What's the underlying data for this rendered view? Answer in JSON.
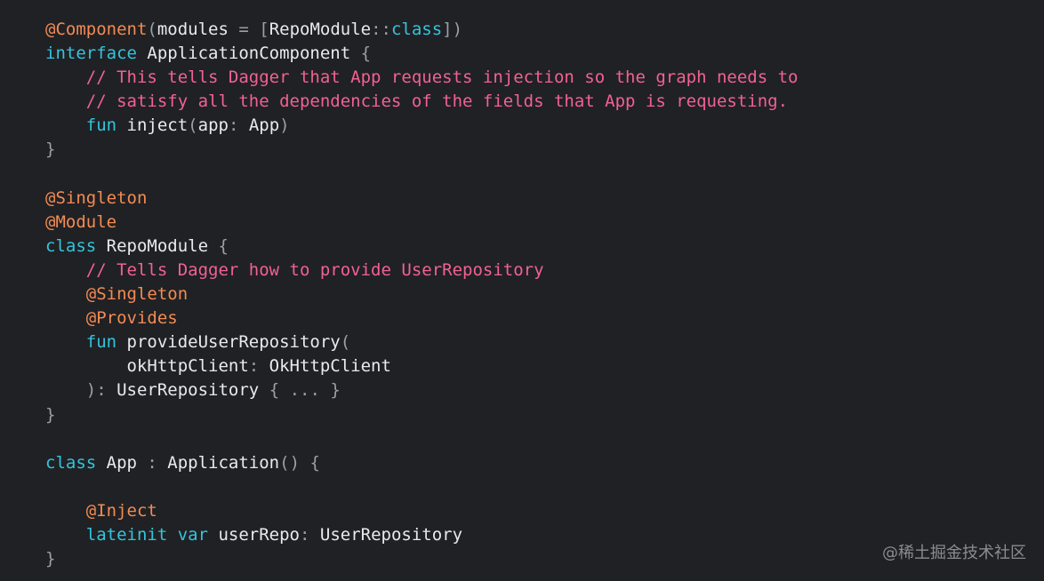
{
  "colors": {
    "background": "#202124",
    "annotation": "#f28b54",
    "keyword": "#33c4de",
    "comment": "#f06292",
    "punctuation": "#9aa0a6",
    "identifier": "#e8eaed"
  },
  "code": {
    "lines": [
      [
        [
          "ann",
          "@Component"
        ],
        [
          "pn",
          "("
        ],
        [
          "id",
          "modules "
        ],
        [
          "pn",
          "= ["
        ],
        [
          "id",
          "RepoModule"
        ],
        [
          "pn",
          "::"
        ],
        [
          "kw",
          "class"
        ],
        [
          "pn",
          "])"
        ]
      ],
      [
        [
          "kw",
          "interface "
        ],
        [
          "id",
          "ApplicationComponent "
        ],
        [
          "pn",
          "{"
        ]
      ],
      [
        [
          "id",
          "    "
        ],
        [
          "cm",
          "// This tells Dagger that App requests injection so the graph needs to"
        ]
      ],
      [
        [
          "id",
          "    "
        ],
        [
          "cm",
          "// satisfy all the dependencies of the fields that App is requesting."
        ]
      ],
      [
        [
          "id",
          "    "
        ],
        [
          "kw",
          "fun "
        ],
        [
          "id",
          "inject"
        ],
        [
          "pn",
          "("
        ],
        [
          "id",
          "app"
        ],
        [
          "pn",
          ": "
        ],
        [
          "id",
          "App"
        ],
        [
          "pn",
          ")"
        ]
      ],
      [
        [
          "pn",
          "}"
        ]
      ],
      [],
      [
        [
          "ann",
          "@Singleton"
        ]
      ],
      [
        [
          "ann",
          "@Module"
        ]
      ],
      [
        [
          "kw",
          "class "
        ],
        [
          "id",
          "RepoModule "
        ],
        [
          "pn",
          "{"
        ]
      ],
      [
        [
          "id",
          "    "
        ],
        [
          "cm",
          "// Tells Dagger how to provide UserRepository"
        ]
      ],
      [
        [
          "id",
          "    "
        ],
        [
          "ann",
          "@Singleton"
        ]
      ],
      [
        [
          "id",
          "    "
        ],
        [
          "ann",
          "@Provides"
        ]
      ],
      [
        [
          "id",
          "    "
        ],
        [
          "kw",
          "fun "
        ],
        [
          "id",
          "provideUserRepository"
        ],
        [
          "pn",
          "("
        ]
      ],
      [
        [
          "id",
          "        okHttpClient"
        ],
        [
          "pn",
          ": "
        ],
        [
          "id",
          "OkHttpClient"
        ]
      ],
      [
        [
          "id",
          "    "
        ],
        [
          "pn",
          "): "
        ],
        [
          "id",
          "UserRepository "
        ],
        [
          "pn",
          "{ ... }"
        ]
      ],
      [
        [
          "pn",
          "}"
        ]
      ],
      [],
      [
        [
          "kw",
          "class "
        ],
        [
          "id",
          "App "
        ],
        [
          "pn",
          ": "
        ],
        [
          "id",
          "Application"
        ],
        [
          "pn",
          "() {"
        ]
      ],
      [],
      [
        [
          "id",
          "    "
        ],
        [
          "ann",
          "@Inject"
        ]
      ],
      [
        [
          "id",
          "    "
        ],
        [
          "kw",
          "lateinit var "
        ],
        [
          "id",
          "userRepo"
        ],
        [
          "pn",
          ": "
        ],
        [
          "id",
          "UserRepository"
        ]
      ],
      [
        [
          "pn",
          "}"
        ]
      ]
    ]
  },
  "watermark": {
    "text": "@稀土掘金技术社区"
  }
}
